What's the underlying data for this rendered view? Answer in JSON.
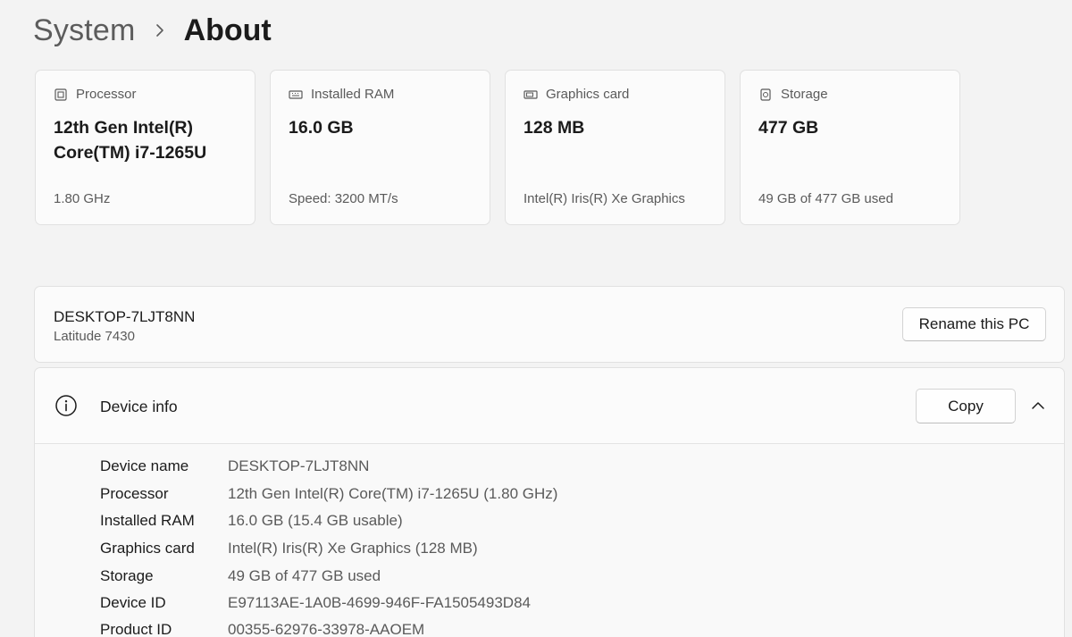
{
  "breadcrumb": {
    "parent": "System",
    "current": "About"
  },
  "cards": [
    {
      "icon": "processor-icon",
      "title": "Processor",
      "value": "12th Gen Intel(R) Core(TM) i7-1265U",
      "sub": "1.80 GHz"
    },
    {
      "icon": "memory-icon",
      "title": "Installed RAM",
      "value": "16.0 GB",
      "sub": "Speed: 3200 MT/s"
    },
    {
      "icon": "graphics-card-icon",
      "title": "Graphics card",
      "value": "128 MB",
      "sub": "Intel(R) Iris(R) Xe Graphics"
    },
    {
      "icon": "storage-icon",
      "title": "Storage",
      "value": "477 GB",
      "sub": "49 GB of 477 GB used"
    }
  ],
  "pc": {
    "name": "DESKTOP-7LJT8NN",
    "model": "Latitude 7430",
    "rename_label": "Rename this PC"
  },
  "device_info": {
    "title": "Device info",
    "copy_label": "Copy",
    "rows": [
      {
        "label": "Device name",
        "value": "DESKTOP-7LJT8NN"
      },
      {
        "label": "Processor",
        "value": "12th Gen Intel(R) Core(TM) i7-1265U (1.80 GHz)"
      },
      {
        "label": "Installed RAM",
        "value": "16.0 GB (15.4 GB usable)"
      },
      {
        "label": "Graphics card",
        "value": "Intel(R) Iris(R) Xe Graphics (128 MB)"
      },
      {
        "label": "Storage",
        "value": "49 GB of 477 GB used"
      },
      {
        "label": "Device ID",
        "value": "E97113AE-1A0B-4699-946F-FA1505493D84"
      },
      {
        "label": "Product ID",
        "value": "00355-62976-33978-AAOEM"
      }
    ]
  }
}
